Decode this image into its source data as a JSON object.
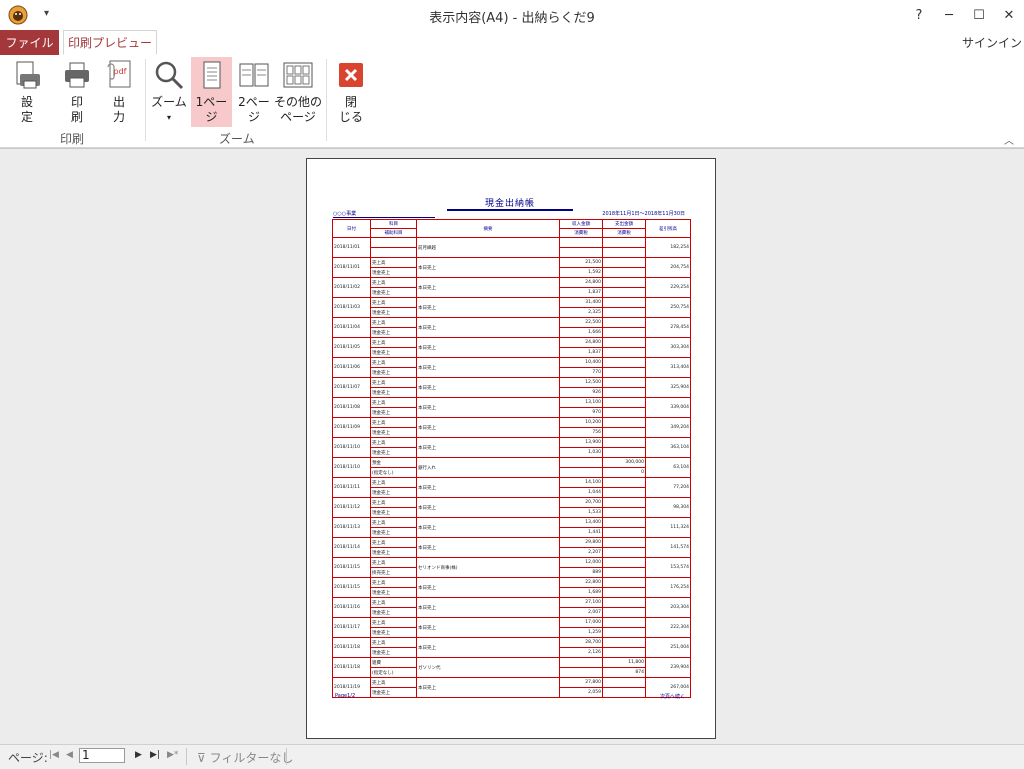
{
  "window": {
    "title": "表示内容(A4) - 出納らくだ9",
    "help": "?",
    "minimize": "─",
    "maximize": "☐",
    "close": "✕"
  },
  "tabs": {
    "file": "ファイル",
    "print_preview": "印刷プレビュー",
    "signin": "サインイン"
  },
  "ribbon": {
    "settings": "設\n定",
    "print": "印\n刷",
    "output": "出\n力",
    "zoom": "ズーム",
    "one_page": "1ペー\nジ",
    "two_page": "2ペー\nジ",
    "other_pages": "その他の\nページ",
    "close": "閉\nじる",
    "group_print": "印刷",
    "group_zoom": "ズーム"
  },
  "report": {
    "title": "現金出納帳",
    "owner": "○○○事業",
    "period": "2018年11月1日～2018年11月30日",
    "headers": {
      "date": "日付",
      "account": "科目",
      "sub_account": "補助科目",
      "summary": "摘要",
      "income": "収入金額",
      "income_tax": "消費税",
      "expense": "支出金額",
      "expense_tax": "消費税",
      "balance": "差引残高"
    },
    "rows": [
      {
        "date": "2018/11/01",
        "acc": "",
        "sub": "",
        "desc": "前月繰越",
        "inc": "",
        "inc_tax": "",
        "exp": "",
        "exp_tax": "",
        "bal": "182,254"
      },
      {
        "date": "2018/11/01",
        "acc": "売上高",
        "sub": "現金売上",
        "desc": "本日売上",
        "inc": "21,500",
        "inc_tax": "1,592",
        "exp": "",
        "exp_tax": "",
        "bal": "204,754"
      },
      {
        "date": "2018/11/02",
        "acc": "売上高",
        "sub": "現金売上",
        "desc": "本日売上",
        "inc": "24,800",
        "inc_tax": "1,837",
        "exp": "",
        "exp_tax": "",
        "bal": "229,254"
      },
      {
        "date": "2018/11/03",
        "acc": "売上高",
        "sub": "現金売上",
        "desc": "本日売上",
        "inc": "31,400",
        "inc_tax": "2,325",
        "exp": "",
        "exp_tax": "",
        "bal": "250,754"
      },
      {
        "date": "2018/11/04",
        "acc": "売上高",
        "sub": "現金売上",
        "desc": "本日売上",
        "inc": "22,500",
        "inc_tax": "1,666",
        "exp": "",
        "exp_tax": "",
        "bal": "278,454"
      },
      {
        "date": "2018/11/05",
        "acc": "売上高",
        "sub": "現金売上",
        "desc": "本日売上",
        "inc": "24,800",
        "inc_tax": "1,837",
        "exp": "",
        "exp_tax": "",
        "bal": "303,304"
      },
      {
        "date": "2018/11/06",
        "acc": "売上高",
        "sub": "現金売上",
        "desc": "本日売上",
        "inc": "10,400",
        "inc_tax": "770",
        "exp": "",
        "exp_tax": "",
        "bal": "313,404"
      },
      {
        "date": "2018/11/07",
        "acc": "売上高",
        "sub": "現金売上",
        "desc": "本日売上",
        "inc": "12,500",
        "inc_tax": "926",
        "exp": "",
        "exp_tax": "",
        "bal": "325,904"
      },
      {
        "date": "2018/11/08",
        "acc": "売上高",
        "sub": "現金売上",
        "desc": "本日売上",
        "inc": "13,100",
        "inc_tax": "970",
        "exp": "",
        "exp_tax": "",
        "bal": "339,004"
      },
      {
        "date": "2018/11/09",
        "acc": "売上高",
        "sub": "現金売上",
        "desc": "本日売上",
        "inc": "10,200",
        "inc_tax": "756",
        "exp": "",
        "exp_tax": "",
        "bal": "349,204"
      },
      {
        "date": "2018/11/10",
        "acc": "売上高",
        "sub": "現金売上",
        "desc": "本日売上",
        "inc": "13,900",
        "inc_tax": "1,030",
        "exp": "",
        "exp_tax": "",
        "bal": "363,104"
      },
      {
        "date": "2018/11/10",
        "acc": "預金",
        "sub": "(指定なし)",
        "desc": "銀行入れ",
        "inc": "",
        "inc_tax": "",
        "exp": "300,000",
        "exp_tax": "0",
        "bal": "63,104"
      },
      {
        "date": "2018/11/11",
        "acc": "売上高",
        "sub": "現金売上",
        "desc": "本日売上",
        "inc": "14,100",
        "inc_tax": "1,044",
        "exp": "",
        "exp_tax": "",
        "bal": "77,204"
      },
      {
        "date": "2018/11/12",
        "acc": "売上高",
        "sub": "現金売上",
        "desc": "本日売上",
        "inc": "20,700",
        "inc_tax": "1,533",
        "exp": "",
        "exp_tax": "",
        "bal": "98,304"
      },
      {
        "date": "2018/11/13",
        "acc": "売上高",
        "sub": "現金売上",
        "desc": "本日売上",
        "inc": "13,400",
        "inc_tax": "1,441",
        "exp": "",
        "exp_tax": "",
        "bal": "111,324"
      },
      {
        "date": "2018/11/14",
        "acc": "売上高",
        "sub": "現金売上",
        "desc": "本日売上",
        "inc": "29,800",
        "inc_tax": "2,207",
        "exp": "",
        "exp_tax": "",
        "bal": "141,574"
      },
      {
        "date": "2018/11/15",
        "acc": "売上高",
        "sub": "掛売売上",
        "desc": "セリオンド商事(株)",
        "inc": "12,000",
        "inc_tax": "889",
        "exp": "",
        "exp_tax": "",
        "bal": "153,574"
      },
      {
        "date": "2018/11/15",
        "acc": "売上高",
        "sub": "現金売上",
        "desc": "本日売上",
        "inc": "22,800",
        "inc_tax": "1,689",
        "exp": "",
        "exp_tax": "",
        "bal": "176,254"
      },
      {
        "date": "2018/11/16",
        "acc": "売上高",
        "sub": "現金売上",
        "desc": "本日売上",
        "inc": "27,100",
        "inc_tax": "2,007",
        "exp": "",
        "exp_tax": "",
        "bal": "203,304"
      },
      {
        "date": "2018/11/17",
        "acc": "売上高",
        "sub": "現金売上",
        "desc": "本日売上",
        "inc": "17,000",
        "inc_tax": "1,259",
        "exp": "",
        "exp_tax": "",
        "bal": "222,304"
      },
      {
        "date": "2018/11/18",
        "acc": "売上高",
        "sub": "現金売上",
        "desc": "本日売上",
        "inc": "28,700",
        "inc_tax": "2,126",
        "exp": "",
        "exp_tax": "",
        "bal": "251,004"
      },
      {
        "date": "2018/11/18",
        "acc": "雑費",
        "sub": "(指定なし)",
        "desc": "ガソリン代",
        "inc": "",
        "inc_tax": "",
        "exp": "11,800",
        "exp_tax": "874",
        "bal": "239,904"
      },
      {
        "date": "2018/11/19",
        "acc": "売上高",
        "sub": "現金売上",
        "desc": "本日売上",
        "inc": "27,800",
        "inc_tax": "2,059",
        "exp": "",
        "exp_tax": "",
        "bal": "267,004"
      }
    ],
    "footer_left": "Page1/2",
    "footer_right": "次頁へ続く"
  },
  "statusbar": {
    "page_label": "ページ:",
    "page_value": "1",
    "first": "|◀",
    "prev": "◀",
    "next": "▶",
    "last": "▶|",
    "new": "▶*",
    "filter": "フィルターなし"
  },
  "colors": {
    "accent": "#a4373a",
    "active_button": "#f8c9cb",
    "rule": "#cc0000",
    "report_text": "#00008b"
  }
}
